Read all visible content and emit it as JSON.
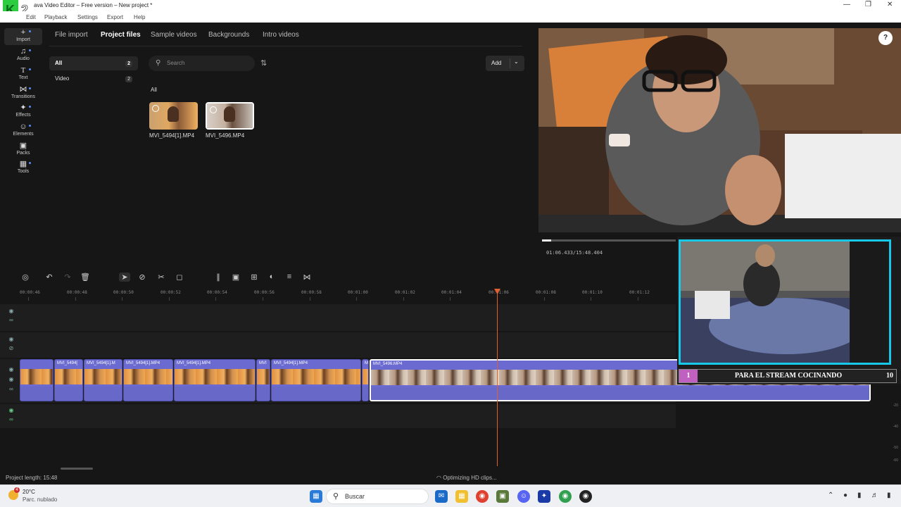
{
  "window": {
    "title": "Movavi Video Editor – Free version – New project *",
    "title_visible": "ava Video Editor – Free version – New project *",
    "controls": [
      "minimize-icon",
      "restore-icon",
      "close-icon"
    ]
  },
  "menu": [
    "Edit",
    "Playback",
    "Settings",
    "Export",
    "Help"
  ],
  "rail": [
    {
      "label": "Import",
      "icon": "plus-icon",
      "active": true
    },
    {
      "label": "Audio",
      "icon": "music-note-icon"
    },
    {
      "label": "Text",
      "icon": "text-icon"
    },
    {
      "label": "Transitions",
      "icon": "transitions-icon"
    },
    {
      "label": "Effects",
      "icon": "effects-icon"
    },
    {
      "label": "Elements",
      "icon": "elements-icon"
    },
    {
      "label": "Packs",
      "icon": "packs-icon"
    },
    {
      "label": "Tools",
      "icon": "tools-icon"
    }
  ],
  "tabs": [
    "File import",
    "Project files",
    "Sample videos",
    "Backgrounds",
    "Intro videos"
  ],
  "active_tab": "Project files",
  "categories": [
    {
      "label": "All",
      "count": "2",
      "selected": true
    },
    {
      "label": "Video",
      "count": "2",
      "selected": false
    }
  ],
  "search": {
    "placeholder": "Search"
  },
  "add_button": {
    "label": "Add"
  },
  "section_label": "All",
  "files": [
    {
      "name": "MVI_5494[1].MP4",
      "selected": false
    },
    {
      "name": "MVI_5496.MP4",
      "selected": true
    }
  ],
  "preview": {
    "timecode": "01:06.433/15:48.404",
    "progress": 0.07
  },
  "overlay": {
    "left_num": "1",
    "caption": "PARA EL STREAM COCINANDO",
    "right_num": "10"
  },
  "ruler": [
    "00:00:46",
    "00:00:48",
    "00:00:50",
    "00:00:52",
    "00:00:54",
    "00:00:56",
    "00:00:58",
    "00:01:00",
    "00:01:02",
    "00:01:04",
    "00:01:06",
    "00:01:08",
    "00:01:10",
    "00:01:12"
  ],
  "clips": [
    {
      "label": "",
      "type": "a"
    },
    {
      "label": "MVI_5494[",
      "type": "a"
    },
    {
      "label": "MVI_5494[1].M",
      "type": "a"
    },
    {
      "label": "MVI_5494[1].MP4",
      "type": "a"
    },
    {
      "label": "MVI_5494[1].MP4",
      "type": "a"
    },
    {
      "label": "MVI",
      "type": "a"
    },
    {
      "label": "MVI_5494[1].MP4",
      "type": "a"
    },
    {
      "label": "M",
      "type": "a"
    },
    {
      "label": "MVI_5496.MP4",
      "type": "b"
    }
  ],
  "status": {
    "project_length": "Project length: 15:48",
    "optimizing": "Optimizing HD clips..."
  },
  "meter_labels": [
    "-20",
    "-30",
    "-40",
    "-50",
    "-60"
  ],
  "taskbar": {
    "weather_temp": "20°C",
    "weather_desc": "Parc. nublado",
    "weather_badge": "4",
    "search_placeholder": "Buscar"
  }
}
